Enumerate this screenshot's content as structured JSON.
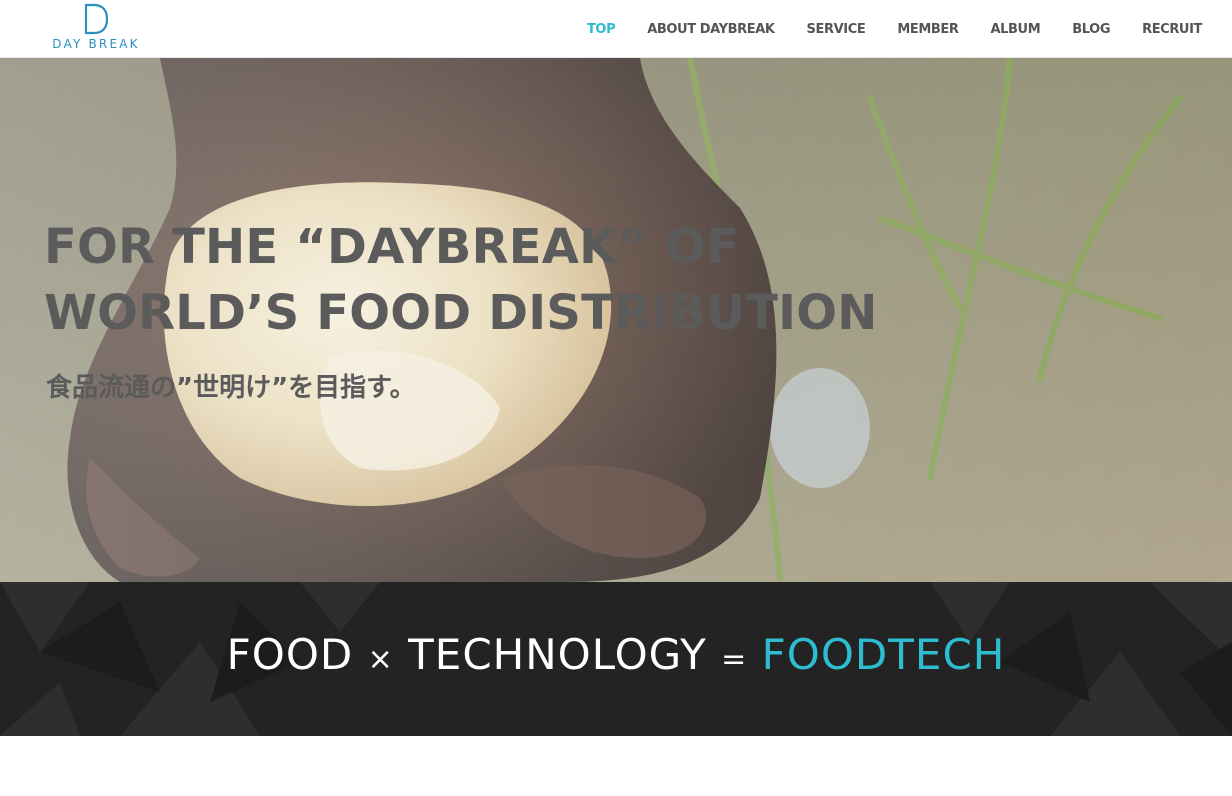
{
  "header": {
    "logo": {
      "mark": "D",
      "text": "DAY BREAK"
    },
    "nav": [
      {
        "label": "TOP",
        "active": true
      },
      {
        "label": "ABOUT DAYBREAK",
        "active": false
      },
      {
        "label": "SERVICE",
        "active": false
      },
      {
        "label": "MEMBER",
        "active": false
      },
      {
        "label": "ALBUM",
        "active": false
      },
      {
        "label": "BLOG",
        "active": false
      },
      {
        "label": "RECRUIT",
        "active": false
      }
    ]
  },
  "hero": {
    "title_line1": "FOR THE “DAYBREAK” OF",
    "title_line2": "WORLD’S FOOD DISTRIBUTION",
    "subtitle": "食品流通の”世明け”を目指す。"
  },
  "band": {
    "part1": "FOOD",
    "op1": "×",
    "part2": "TECHNOLOGY",
    "op2": "=",
    "accent": "FOODTECH"
  },
  "colors": {
    "accent": "#2dbcd0",
    "nav_text": "#555555",
    "hero_text": "#5b5b5b",
    "band_bg": "#232323",
    "logo": "#2b8fbf"
  }
}
